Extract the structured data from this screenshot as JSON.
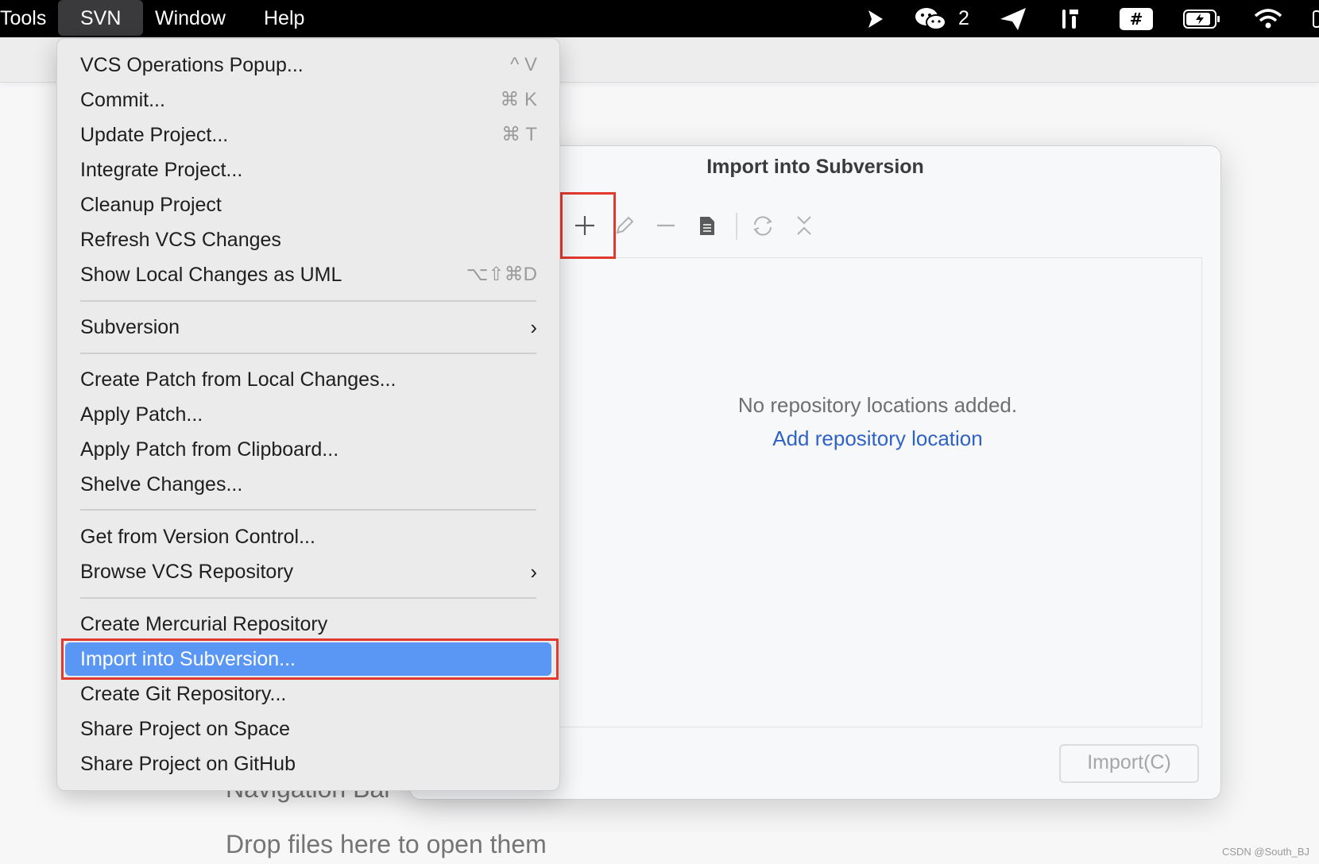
{
  "menubar": {
    "items": [
      "Tools",
      "SVN",
      "Window",
      "Help"
    ],
    "wechat_count": "2"
  },
  "background": {
    "navigation_bar": "Navigation Bar",
    "drop_hint": "Drop files here to open them"
  },
  "dialog": {
    "title": "Import into Subversion",
    "empty_text": "No repository locations added.",
    "empty_link": "Add repository location",
    "import_button": "Import(C)"
  },
  "menu": {
    "items": [
      {
        "label": "VCS Operations Popup...",
        "shortcut": "^ V"
      },
      {
        "label": "Commit...",
        "shortcut": "⌘ K"
      },
      {
        "label": "Update Project...",
        "shortcut": "⌘ T"
      },
      {
        "label": "Integrate Project...",
        "shortcut": ""
      },
      {
        "label": "Cleanup Project",
        "shortcut": ""
      },
      {
        "label": "Refresh VCS Changes",
        "shortcut": ""
      },
      {
        "label": "Show Local Changes as UML",
        "shortcut": "⌥⇧⌘D"
      },
      {
        "label": "Subversion",
        "shortcut": ""
      },
      {
        "label": "Create Patch from Local Changes...",
        "shortcut": ""
      },
      {
        "label": "Apply Patch...",
        "shortcut": ""
      },
      {
        "label": "Apply Patch from Clipboard...",
        "shortcut": ""
      },
      {
        "label": "Shelve Changes...",
        "shortcut": ""
      },
      {
        "label": "Get from Version Control...",
        "shortcut": ""
      },
      {
        "label": "Browse VCS Repository",
        "shortcut": ""
      },
      {
        "label": "Create Mercurial Repository",
        "shortcut": ""
      },
      {
        "label": "Import into Subversion...",
        "shortcut": ""
      },
      {
        "label": "Create Git Repository...",
        "shortcut": ""
      },
      {
        "label": "Share Project on Space",
        "shortcut": ""
      },
      {
        "label": "Share Project on GitHub",
        "shortcut": ""
      }
    ]
  },
  "watermark": "CSDN @South_BJ",
  "colors": {
    "selection": "#5a97f5",
    "highlight_border": "#e0392d",
    "link": "#2f62c6"
  }
}
